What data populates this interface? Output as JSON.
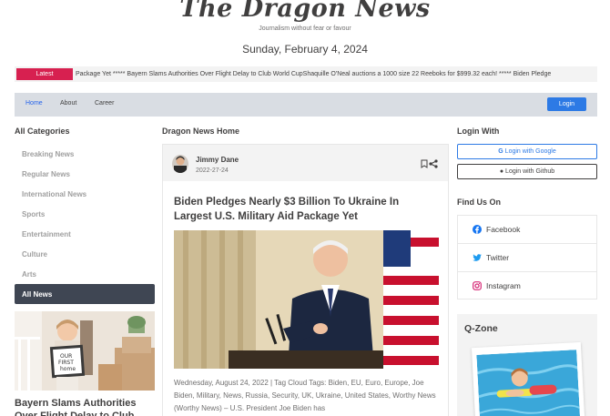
{
  "header": {
    "logo": "The Dragon News",
    "tagline": "Journalism without fear or favour",
    "date": "Sunday, February 4, 2024"
  },
  "ticker": {
    "label": "Latest",
    "text": "Package Yet ***** Bayern Slams Authorities Over Flight Delay to Club World CupShaquille O'Neal auctions a 1000 size 22 Reeboks for $999.32 each! ***** Biden Pledge"
  },
  "nav": {
    "home": "Home",
    "about": "About",
    "career": "Career",
    "login": "Login"
  },
  "left": {
    "title": "All Categories",
    "categories": [
      "Breaking News",
      "Regular News",
      "International News",
      "Sports",
      "Entertainment",
      "Culture",
      "Arts"
    ],
    "active_category": "All News",
    "sign_text": [
      "OUR",
      "FIRST",
      "home"
    ],
    "headline": "Bayern Slams Authorities Over Flight Delay to Club World Cup"
  },
  "center": {
    "title": "Dragon News Home",
    "author": "Jimmy Dane",
    "date": "2022-27-24",
    "article_title": "Biden Pledges Nearly $3 Billion To Ukraine In Largest U.S. Military Aid Package Yet",
    "description": "Wednesday, August 24, 2022 | Tag Cloud Tags: Biden, EU, Euro, Europe, Joe Biden, Military, News, Russia, Security, UK, Ukraine, United States, Worthy News (Worthy News) – U.S. President Joe Biden has"
  },
  "right": {
    "login_title": "Login With",
    "google": "Login with Google",
    "github": "Login with Github",
    "find_title": "Find Us On",
    "facebook": "Facebook",
    "twitter": "Twitter",
    "instagram": "Instagram",
    "qzone_title": "Q-Zone"
  },
  "colors": {
    "accent_red": "#d72050",
    "primary_blue": "#2d7ae5",
    "dark": "#403f3f"
  }
}
